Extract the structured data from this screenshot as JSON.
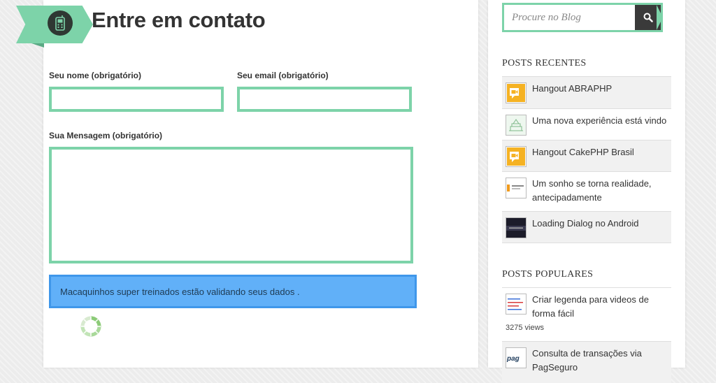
{
  "page": {
    "title": "Entre em contato"
  },
  "form": {
    "name_label": "Seu nome (obrigatório)",
    "name_value": "",
    "email_label": "Seu email (obrigatório)",
    "email_value": "",
    "message_label": "Sua Mensagem (obrigatório)",
    "message_value": "",
    "status_message": "Macaquinhos super treinados estão validando seus dados ."
  },
  "search": {
    "placeholder": "Procure no Blog"
  },
  "recent_posts": {
    "title": "POSTS RECENTES",
    "items": [
      {
        "title": "Hangout ABRAPHP",
        "icon": "hangout-icon"
      },
      {
        "title": "Uma nova experiência está vindo",
        "icon": "cake-sketch-thumbnail"
      },
      {
        "title": "Hangout CakePHP Brasil",
        "icon": "hangout-icon"
      },
      {
        "title": "Um sonho se torna realidade, antecipadamente",
        "icon": "book-cover-thumbnail"
      },
      {
        "title": "Loading Dialog no Android",
        "icon": "android-dialog-thumbnail"
      }
    ]
  },
  "popular_posts": {
    "title": "POSTS POPULARES",
    "items": [
      {
        "title": "Criar legenda para videos de forma fácil",
        "views": "3275 views",
        "icon": "subtitle-code-thumbnail"
      },
      {
        "title": "Consulta de transações via PagSeguro",
        "icon": "pagseguro-logo-thumbnail"
      }
    ]
  },
  "colors": {
    "accent": "#7dd3a9",
    "alert_bg": "#61b0f8",
    "hangout": "#f5b223"
  }
}
